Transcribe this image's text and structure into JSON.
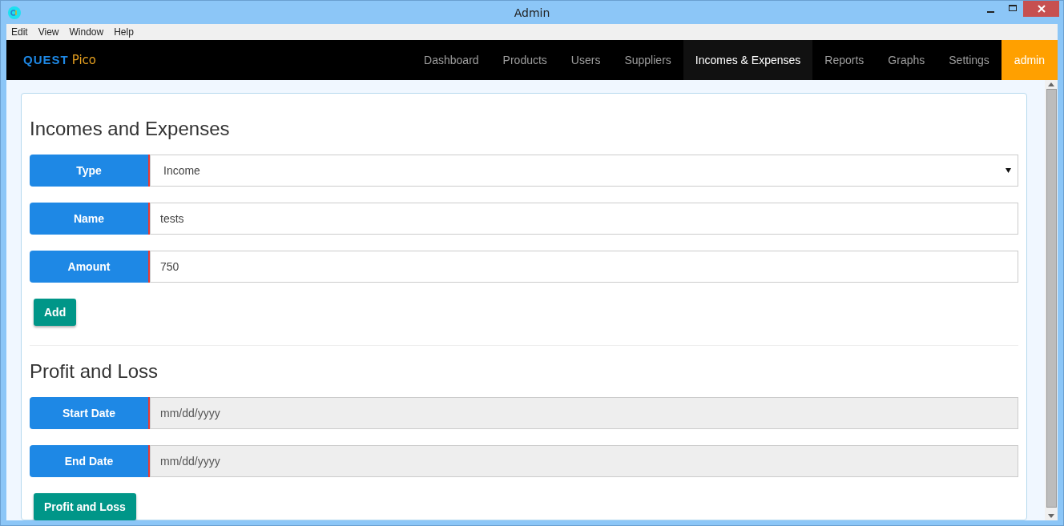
{
  "window": {
    "title": "Admin"
  },
  "menu": [
    "Edit",
    "View",
    "Window",
    "Help"
  ],
  "brand": {
    "first": "QUEST",
    "second": "Pico"
  },
  "nav": [
    {
      "label": "Dashboard",
      "selected": false,
      "kind": "link"
    },
    {
      "label": "Products",
      "selected": false,
      "kind": "link"
    },
    {
      "label": "Users",
      "selected": false,
      "kind": "link"
    },
    {
      "label": "Suppliers",
      "selected": false,
      "kind": "link"
    },
    {
      "label": "Incomes & Expenses",
      "selected": true,
      "kind": "link"
    },
    {
      "label": "Reports",
      "selected": false,
      "kind": "link"
    },
    {
      "label": "Graphs",
      "selected": false,
      "kind": "link"
    },
    {
      "label": "Settings",
      "selected": false,
      "kind": "link"
    },
    {
      "label": "admin",
      "selected": false,
      "kind": "user"
    }
  ],
  "sections": [
    {
      "heading": "Incomes and Expenses",
      "fields": [
        {
          "label": "Type",
          "kind": "select",
          "value": "Income"
        },
        {
          "label": "Name",
          "kind": "text",
          "value": "tests"
        },
        {
          "label": "Amount",
          "kind": "text",
          "value": "750"
        }
      ],
      "button": "Add"
    },
    {
      "heading": "Profit and Loss",
      "fields": [
        {
          "label": "Start Date",
          "kind": "date",
          "placeholder": "mm/dd/yyyy"
        },
        {
          "label": "End Date",
          "kind": "date",
          "placeholder": "mm/dd/yyyy"
        }
      ],
      "button": "Profit and Loss"
    }
  ]
}
